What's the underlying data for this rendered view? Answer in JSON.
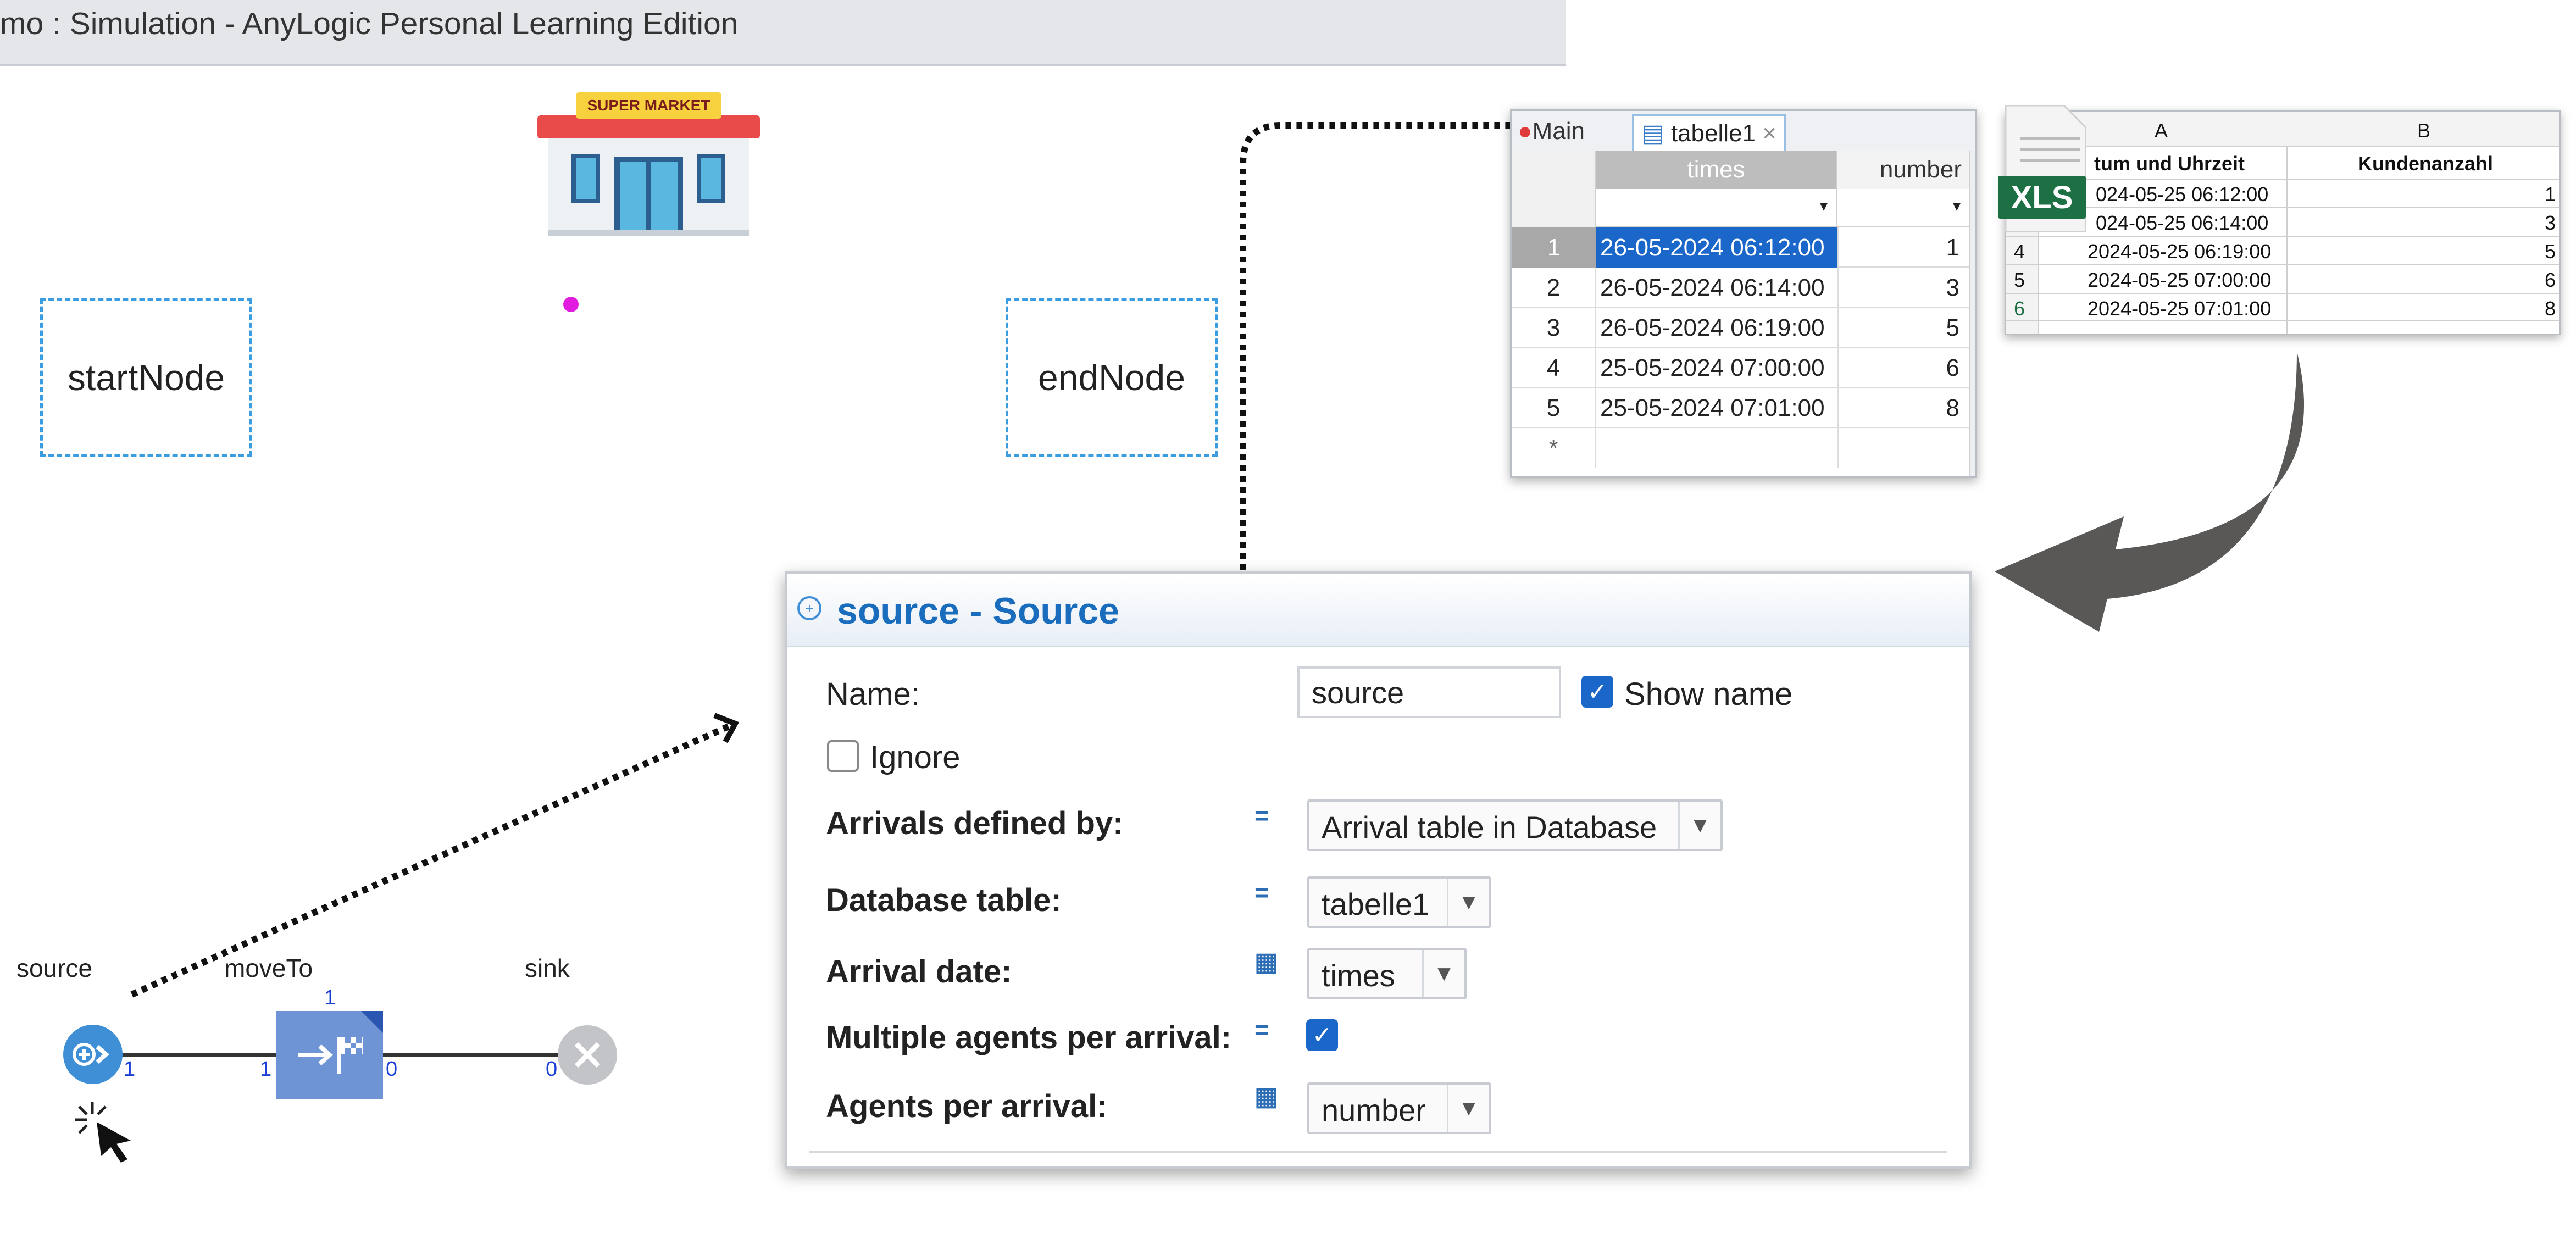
{
  "window": {
    "title": "mo : Simulation - AnyLogic Personal Learning Edition"
  },
  "supermarket": {
    "sign": "SUPER MARKET"
  },
  "nodes": {
    "start": "startNode",
    "end": "endNode"
  },
  "flowchart": {
    "blocks": [
      {
        "label": "source",
        "icon": "source-icon"
      },
      {
        "label": "moveTo",
        "icon": "moveto-flag-icon"
      },
      {
        "label": "sink",
        "icon": "sink-icon"
      }
    ],
    "ports": {
      "source_out": "1",
      "moveto_in": "1",
      "moveto_top": "1",
      "moveto_out": "0",
      "sink_in": "0"
    }
  },
  "panel": {
    "title": "source - Source",
    "name_label": "Name:",
    "name_value": "source",
    "show_name_label": "Show name",
    "show_name_checked": true,
    "ignore_label": "Ignore",
    "ignore_checked": false,
    "arrivals_label": "Arrivals defined by:",
    "arrivals_value": "Arrival table in Database",
    "db_table_label": "Database table:",
    "db_table_value": "tabelle1",
    "arrival_date_label": "Arrival date:",
    "arrival_date_value": "times",
    "multiple_label": "Multiple agents per arrival:",
    "multiple_checked": true,
    "agents_label": "Agents per arrival:",
    "agents_value": "number"
  },
  "db_table": {
    "tabs": [
      "Main",
      "tabelle1"
    ],
    "columns": [
      "times",
      "number"
    ],
    "rows": [
      {
        "n": "1",
        "times": "26-05-2024 06:12:00",
        "number": "1"
      },
      {
        "n": "2",
        "times": "26-05-2024 06:14:00",
        "number": "3"
      },
      {
        "n": "3",
        "times": "26-05-2024 06:19:00",
        "number": "5"
      },
      {
        "n": "4",
        "times": "25-05-2024 07:00:00",
        "number": "6"
      },
      {
        "n": "5",
        "times": "25-05-2024 07:01:00",
        "number": "8"
      }
    ],
    "new_row_marker": "*"
  },
  "excel": {
    "badge": "XLS",
    "col_letters": [
      "A",
      "B"
    ],
    "headers": [
      "tum und Uhrzeit",
      "Kundenanzahl"
    ],
    "rows": [
      {
        "n": "",
        "a": "024-05-25 06:12:00",
        "b": "1"
      },
      {
        "n": "",
        "a": "024-05-25 06:14:00",
        "b": "3"
      },
      {
        "n": "4",
        "a": "2024-05-25 06:19:00",
        "b": "5"
      },
      {
        "n": "5",
        "a": "2024-05-25 07:00:00",
        "b": "6"
      },
      {
        "n": "6",
        "a": "2024-05-25 07:01:00",
        "b": "8"
      }
    ]
  },
  "colors": {
    "accent": "#1a6dbd",
    "selection": "#1b67c9",
    "node_border": "#3b9de1",
    "excel_green": "#1d7044",
    "arrow": "#5a5856"
  }
}
